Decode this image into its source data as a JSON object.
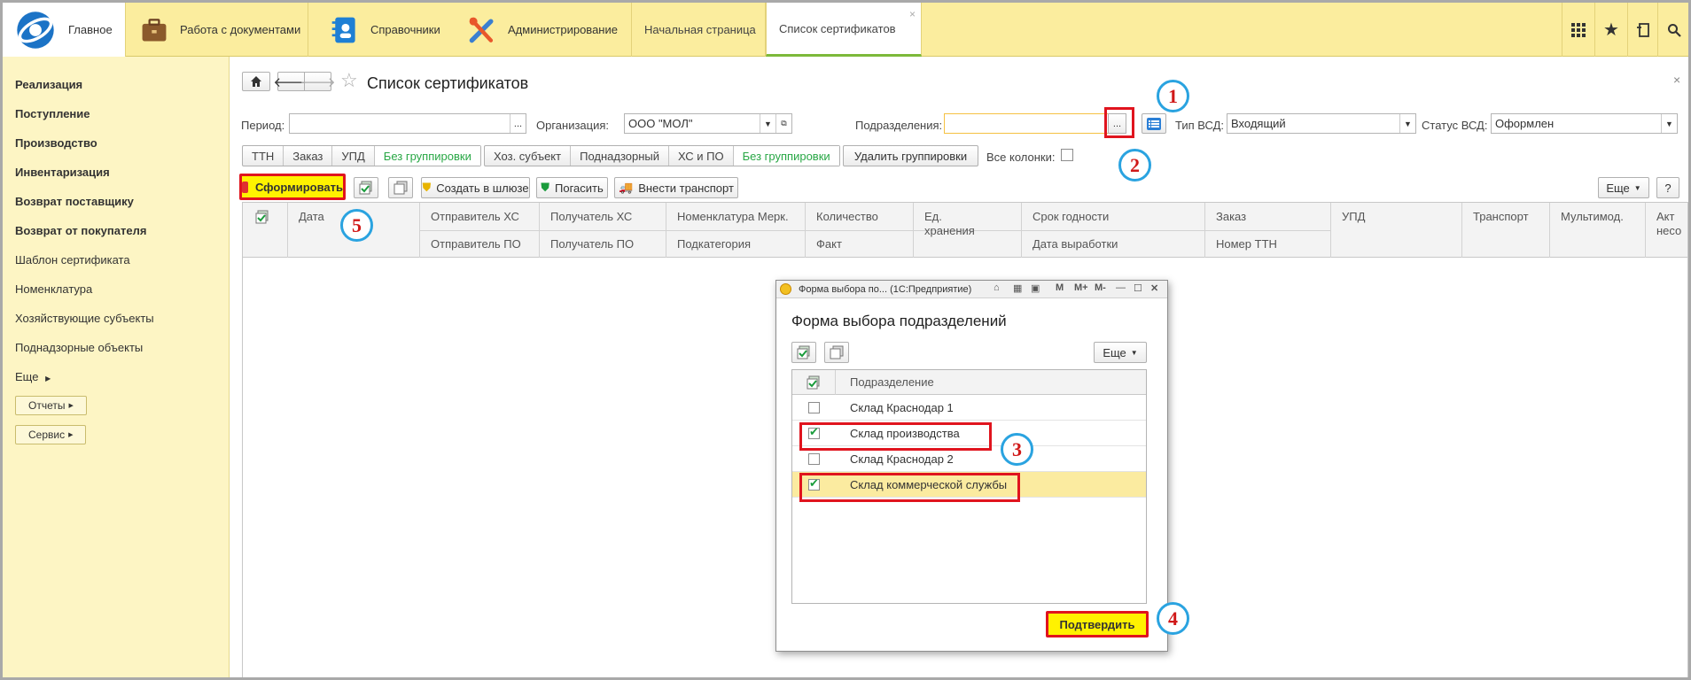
{
  "top": {
    "home": "Главное",
    "sections": [
      "Работа с документами",
      "Справочники",
      "Администрирование"
    ],
    "tabs": [
      "Начальная страница",
      "Список сертификатов"
    ],
    "tab_close": "×"
  },
  "sidebar": {
    "bold_items": [
      "Реализация",
      "Поступление",
      "Производство",
      "Инвентаризация",
      "Возврат поставщику",
      "Возврат от покупателя"
    ],
    "items": [
      "Шаблон сертификата",
      "Номенклатура",
      "Хозяйствующие субъекты",
      "Поднадзорные объекты"
    ],
    "more": "Еще",
    "buttons": [
      "Отчеты",
      "Сервис"
    ]
  },
  "main": {
    "title": "Список сертификатов",
    "close": "×",
    "filters": {
      "period_label": "Период:",
      "period_value": "",
      "org_label": "Организация:",
      "org_value": "ООО \"МОЛ\"",
      "division_label": "Подразделения:",
      "division_value": "",
      "ellipsis": "...",
      "type_label": "Тип ВСД:",
      "type_value": "Входящий",
      "status_label": "Статус ВСД:",
      "status_value": "Оформлен"
    },
    "group1": [
      "ТТН",
      "Заказ",
      "УПД",
      "Без группировки"
    ],
    "group2": [
      "Хоз. субъект",
      "Поднадзорный",
      "ХС и ПО",
      "Без группировки"
    ],
    "delete_group": "Удалить группировки",
    "all_columns": "Все колонки:",
    "toolbar": {
      "generate": "Сформировать",
      "create_gateway": "Создать в шлюзе",
      "redeem": "Погасить",
      "add_transport": "Внести транспорт",
      "more": "Еще",
      "help": "?"
    },
    "columns_top": [
      "Дата",
      "Отправитель ХС",
      "Получатель ХС",
      "Номенклатура Мерк.",
      "Количество",
      "Ед. хранения",
      "Срок годности",
      "Заказ",
      "УПД",
      "Транспорт",
      "Мультимод.",
      "Акт несо"
    ],
    "columns_bottom": [
      "Отправитель ПО",
      "Получатель ПО",
      "Подкатегория",
      "Факт",
      "Дата выработки",
      "Номер ТТН"
    ]
  },
  "dialog": {
    "window_title": "Форма выбора по...  (1С:Предприятие)",
    "window_buttons": [
      "M",
      "M+",
      "M-"
    ],
    "heading": "Форма выбора подразделений",
    "more": "Еще",
    "column": "Подразделение",
    "rows": [
      {
        "label": "Склад Краснодар 1",
        "checked": false
      },
      {
        "label": "Склад производства",
        "checked": true
      },
      {
        "label": "Склад Краснодар 2",
        "checked": false
      },
      {
        "label": "Склад коммерческой службы",
        "checked": true
      }
    ],
    "confirm": "Подтвердить"
  },
  "annotations": [
    "1",
    "2",
    "3",
    "4",
    "5"
  ],
  "colors": {
    "accent_yellow": "#fbed9e",
    "sidebar": "#fdf5c4",
    "highlight_red": "#e0141e",
    "circle_blue": "#2aa3e0",
    "green": "#28a745"
  }
}
